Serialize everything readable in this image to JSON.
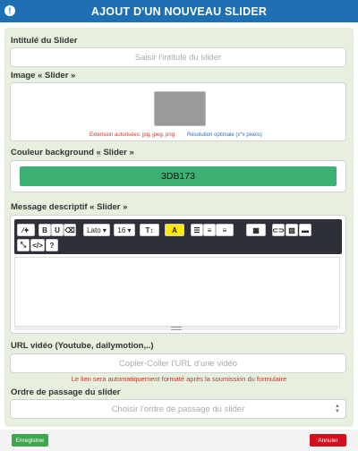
{
  "header": {
    "title": "AJOUT D'UN NOUVEAU SLIDER",
    "info_glyph": "!"
  },
  "title_field": {
    "label": "Intitulé du Slider",
    "placeholder": "Saisir l'intitulé du slider"
  },
  "image_field": {
    "label": "Image « Slider »",
    "extension_note": "Extension autorisées: jpg, jpeg, png",
    "resolution_note": "Résolution optimale (x*x pixels)"
  },
  "color_field": {
    "label": "Couleur background « Slider »",
    "value": "3DB173",
    "color": "#3DB173"
  },
  "message_field": {
    "label": "Message descriptif « Slider »",
    "toolbar": {
      "magic": "⁄✦",
      "bold": "B",
      "underline": "U",
      "eraser": "⌫",
      "font_name": "Lato",
      "font_size": "16",
      "text_style": "T↕",
      "color": "A",
      "bullets": "☰",
      "numbers": "≡",
      "align": "≡",
      "table": "▦",
      "link": "⊂⊃",
      "picture": "▨",
      "video": "▬",
      "fullscreen": "⤡",
      "code": "</>",
      "help": "?"
    }
  },
  "video_field": {
    "label": "URL vidéo (Youtube, dailymotion,..)",
    "placeholder": "Copier-Coller l'URL d'une vidéo",
    "note": "Le lien sera automatiquement formaté après la soumission du formulaire"
  },
  "order_field": {
    "label": "Ordre de passage du slider",
    "placeholder": "Choisir l'ordre de passage du slider"
  },
  "footer": {
    "save_label": "Enregistrer",
    "cancel_label": "Annuler"
  },
  "colors": {
    "header": "#1f6fb5",
    "body": "#e7efdf",
    "save": "#3da74b",
    "cancel": "#d4101e"
  }
}
